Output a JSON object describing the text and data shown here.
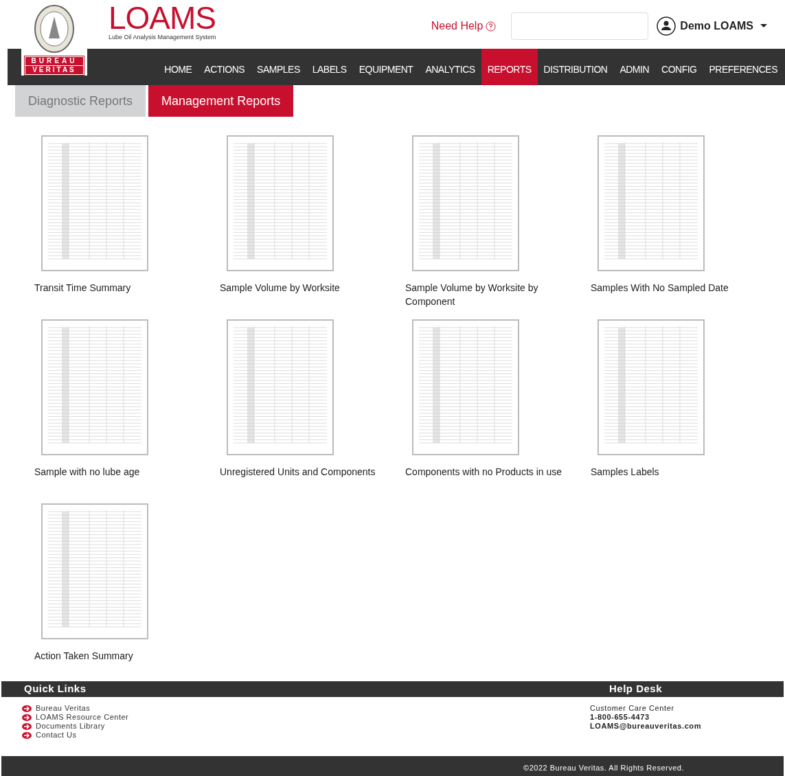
{
  "logo": {
    "brand_top": "BUREAU",
    "brand_bottom": "VERITAS",
    "product": "LOAMS",
    "product_tagline": "Lube Oil Analysis Management System"
  },
  "header": {
    "help": "Need Help",
    "user": "Demo LOAMS"
  },
  "nav": [
    {
      "label": "HOME",
      "selected": false
    },
    {
      "label": "ACTIONS",
      "selected": false
    },
    {
      "label": "SAMPLES",
      "selected": false
    },
    {
      "label": "LABELS",
      "selected": false
    },
    {
      "label": "EQUIPMENT",
      "selected": false
    },
    {
      "label": "ANALYTICS",
      "selected": false
    },
    {
      "label": "REPORTS",
      "selected": true
    },
    {
      "label": "DISTRIBUTION",
      "selected": false
    },
    {
      "label": "ADMIN",
      "selected": false
    },
    {
      "label": "CONFIG",
      "selected": false
    },
    {
      "label": "PREFERENCES",
      "selected": false
    }
  ],
  "tabs": [
    {
      "label": "Diagnostic Reports",
      "selected": false
    },
    {
      "label": "Management Reports",
      "selected": true
    }
  ],
  "reports": [
    {
      "title": "Transit Time Summary"
    },
    {
      "title": "Sample Volume by Worksite"
    },
    {
      "title": "Sample Volume by Worksite by Component"
    },
    {
      "title": "Samples With No Sampled Date"
    },
    {
      "title": "Sample with no lube age"
    },
    {
      "title": "Unregistered Units and Components"
    },
    {
      "title": "Components with no Products in use"
    },
    {
      "title": "Samples Labels"
    },
    {
      "title": "Action Taken Summary"
    }
  ],
  "footer": {
    "quick_links_title": "Quick Links",
    "quick_links": [
      "Bureau Veritas",
      "LOAMS Resource Center",
      "Documents Library",
      "Contact Us"
    ],
    "help_desk_title": "Help Desk",
    "help_desk": [
      {
        "text": "Customer Care Center",
        "bold": false
      },
      {
        "text": "1-800-655-4473",
        "bold": true
      },
      {
        "text": "LOAMS@bureauveritas.com",
        "bold": true
      }
    ],
    "copyright": "©2022 Bureau Veritas. All Rights Reserved."
  }
}
